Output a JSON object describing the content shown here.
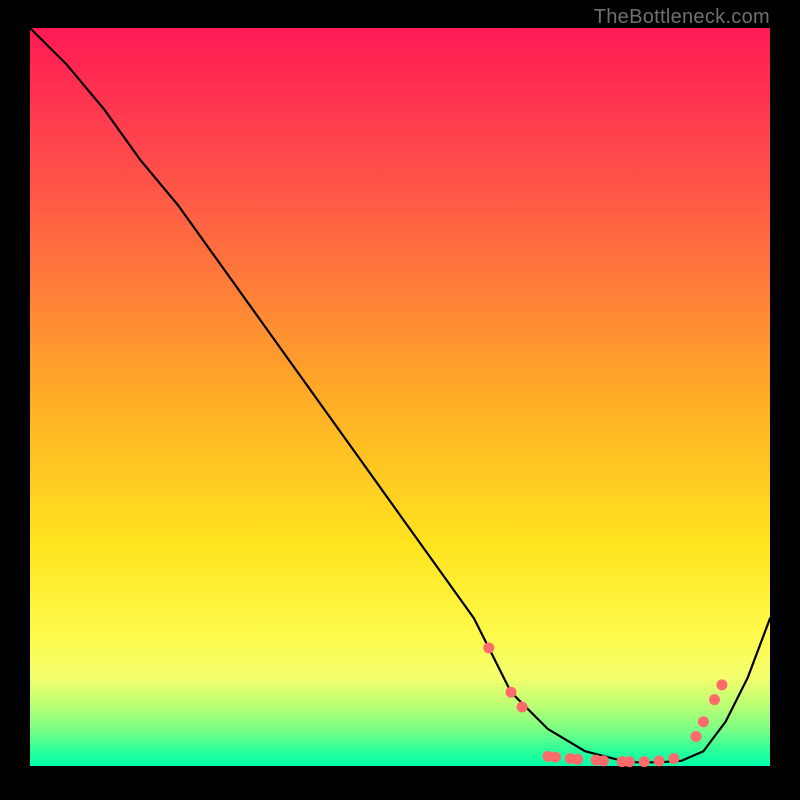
{
  "attribution": "TheBottleneck.com",
  "chart_data": {
    "type": "line",
    "title": "",
    "xlabel": "",
    "ylabel": "",
    "xlim": [
      0,
      100
    ],
    "ylim": [
      0,
      100
    ],
    "gradient_colors": [
      "#ff1a54",
      "#ff4b4b",
      "#ff7a3a",
      "#ffb224",
      "#ffe41f",
      "#fffa4a",
      "#f4ff6e",
      "#b8ff74",
      "#7bff84",
      "#2aff9a",
      "#00ffad"
    ],
    "series": [
      {
        "name": "bottleneck-curve",
        "x": [
          0,
          5,
          10,
          15,
          20,
          25,
          30,
          35,
          40,
          45,
          50,
          55,
          60,
          62,
          65,
          70,
          75,
          80,
          82,
          85,
          88,
          91,
          94,
          97,
          100
        ],
        "y": [
          100,
          95,
          89,
          82,
          76,
          69,
          62,
          55,
          48,
          41,
          34,
          27,
          20,
          16,
          10,
          5,
          2,
          0.7,
          0.5,
          0.5,
          0.7,
          2,
          6,
          12,
          20
        ]
      }
    ],
    "markers": [
      {
        "x": 62,
        "y": 16
      },
      {
        "x": 65,
        "y": 10
      },
      {
        "x": 66.5,
        "y": 8
      },
      {
        "x": 70,
        "y": 1.3
      },
      {
        "x": 71,
        "y": 1.2
      },
      {
        "x": 73,
        "y": 1.0
      },
      {
        "x": 74,
        "y": 0.9
      },
      {
        "x": 76.5,
        "y": 0.8
      },
      {
        "x": 77.5,
        "y": 0.7
      },
      {
        "x": 80,
        "y": 0.6
      },
      {
        "x": 81,
        "y": 0.6
      },
      {
        "x": 83,
        "y": 0.6
      },
      {
        "x": 85,
        "y": 0.7
      },
      {
        "x": 87,
        "y": 1.0
      },
      {
        "x": 90,
        "y": 4
      },
      {
        "x": 91,
        "y": 6
      },
      {
        "x": 92.5,
        "y": 9
      },
      {
        "x": 93.5,
        "y": 11
      }
    ],
    "marker_color": "#ff6b6b",
    "line_color": "#000000"
  }
}
